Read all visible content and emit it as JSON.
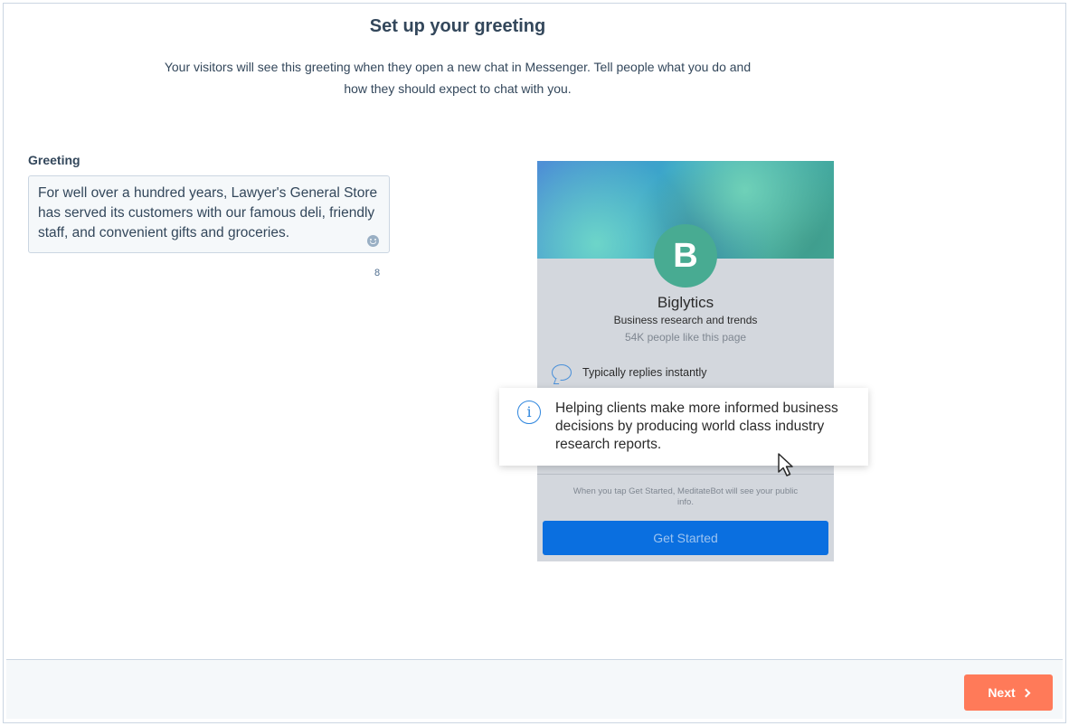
{
  "header": {
    "title": "Set up your greeting",
    "subtitle": "Your visitors will see this greeting when they open a new chat in Messenger. Tell people what you do and how they should expect to chat with you."
  },
  "greeting": {
    "label": "Greeting",
    "value": "For well over a hundred years, Lawyer's General Store has served its customers with our famous deli, friendly staff, and convenient gifts and groceries.",
    "char_count": "8",
    "emoji_icon": "smiley-icon"
  },
  "preview": {
    "avatar_letter": "B",
    "page_name": "Biglytics",
    "page_description": "Business research and trends",
    "page_likes": "54K people like this page",
    "reply_time": "Typically replies instantly",
    "info_text": "Helping clients make more informed business decisions by producing world class industry research reports.",
    "consent_text": "When you tap Get Started, MeditateBot will see your public info.",
    "get_started_label": "Get Started",
    "colors": {
      "avatar": "#48ab92",
      "button": "#0a6fe0",
      "info_icon": "#2e86de"
    }
  },
  "footer": {
    "next_label": "Next",
    "next_color": "#ff7a59"
  }
}
